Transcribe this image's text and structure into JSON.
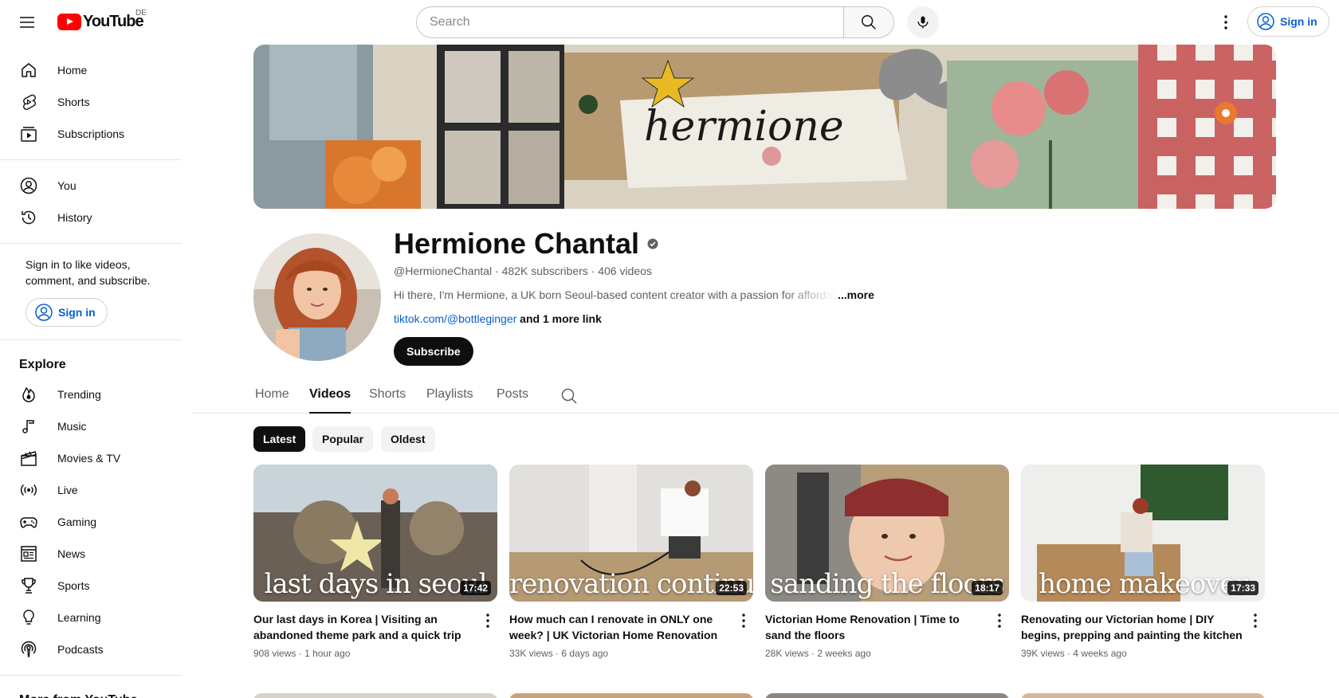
{
  "topbar": {
    "logo_text": "YouTube",
    "region": "DE",
    "search_placeholder": "Search",
    "signin_label": "Sign in"
  },
  "sidebar": {
    "main": [
      {
        "label": "Home",
        "icon": "home-icon"
      },
      {
        "label": "Shorts",
        "icon": "shorts-icon"
      },
      {
        "label": "Subscriptions",
        "icon": "subscriptions-icon"
      }
    ],
    "you": [
      {
        "label": "You",
        "icon": "you-icon"
      },
      {
        "label": "History",
        "icon": "history-icon"
      }
    ],
    "signin_note": "Sign in to like videos, comment, and subscribe.",
    "signin_label": "Sign in",
    "explore_heading": "Explore",
    "explore": [
      {
        "label": "Trending",
        "icon": "trending-icon"
      },
      {
        "label": "Music",
        "icon": "music-icon"
      },
      {
        "label": "Movies & TV",
        "icon": "movies-icon"
      },
      {
        "label": "Live",
        "icon": "live-icon"
      },
      {
        "label": "Gaming",
        "icon": "gaming-icon"
      },
      {
        "label": "News",
        "icon": "news-icon"
      },
      {
        "label": "Sports",
        "icon": "sports-icon"
      },
      {
        "label": "Learning",
        "icon": "learning-icon"
      },
      {
        "label": "Podcasts",
        "icon": "podcasts-icon"
      }
    ],
    "more_heading": "More from YouTube"
  },
  "banner": {
    "text": "hermione"
  },
  "channel": {
    "name": "Hermione Chantal",
    "handle": "@HermioneChantal",
    "subscribers": "482K subscribers",
    "videos": "406 videos",
    "description": "Hi there, I'm Hermione, a UK born Seoul-based content creator with a passion for affordable",
    "more": "...more",
    "link": "tiktok.com/@bottleginger",
    "more_links": "and 1 more link",
    "subscribe_label": "Subscribe"
  },
  "tabs": [
    "Home",
    "Videos",
    "Shorts",
    "Playlists",
    "Posts"
  ],
  "active_tab": "Videos",
  "chips": [
    "Latest",
    "Popular",
    "Oldest"
  ],
  "active_chip": "Latest",
  "videos": [
    {
      "overlay": "last days in seoul",
      "duration": "17:42",
      "title": "Our last days in Korea | Visiting an abandoned theme park and a quick trip to…",
      "views": "908 views",
      "age": "1 hour ago"
    },
    {
      "overlay": "renovation continues",
      "duration": "22:53",
      "title": "How much can I renovate in ONLY one week? | UK Victorian Home Renovation",
      "views": "33K views",
      "age": "6 days ago"
    },
    {
      "overlay": "sanding the floors",
      "duration": "18:17",
      "title": "Victorian Home Renovation | Time to sand the floors",
      "views": "28K views",
      "age": "2 weeks ago"
    },
    {
      "overlay": "home makeover",
      "duration": "17:33",
      "title": "Renovating our Victorian home | DIY begins, prepping and painting the kitchen",
      "views": "39K views",
      "age": "4 weeks ago"
    }
  ],
  "colors": {
    "accent_link": "#065fd4",
    "brand_red": "#ff0000",
    "text": "#0f0f0f",
    "muted": "#606060"
  }
}
